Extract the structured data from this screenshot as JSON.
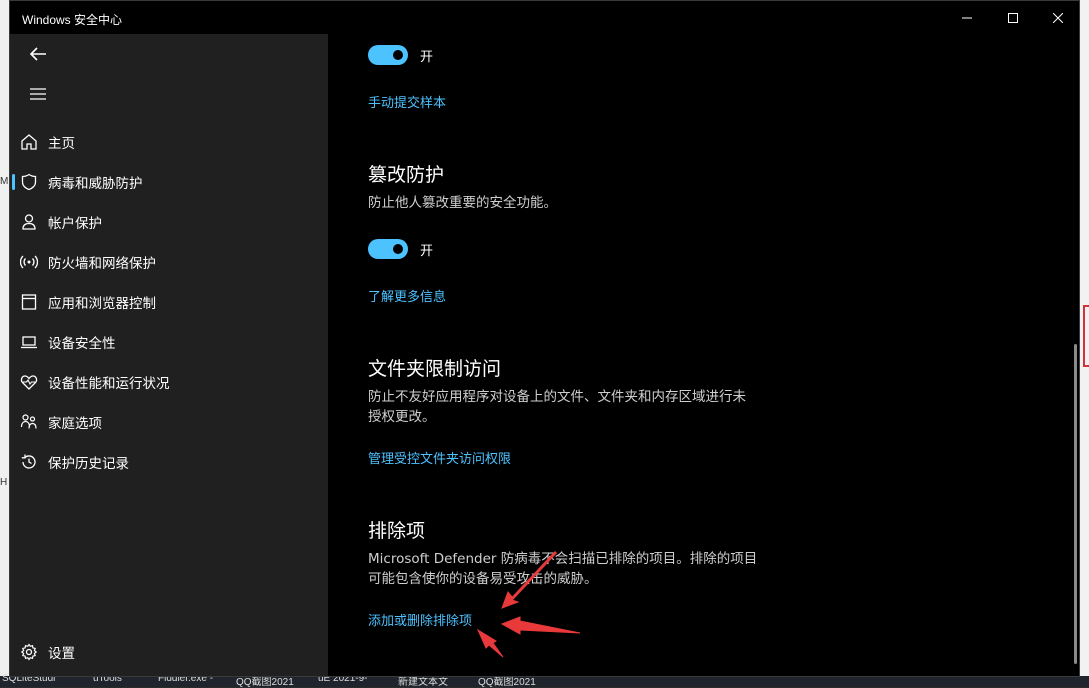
{
  "window": {
    "title": "Windows 安全中心"
  },
  "nav": {
    "items": [
      {
        "label": "主页",
        "icon": "home-icon"
      },
      {
        "label": "病毒和威胁防护",
        "icon": "shield-icon",
        "active": true
      },
      {
        "label": "帐户保护",
        "icon": "person-icon"
      },
      {
        "label": "防火墙和网络保护",
        "icon": "wifi-antenna-icon"
      },
      {
        "label": "应用和浏览器控制",
        "icon": "app-window-icon"
      },
      {
        "label": "设备安全性",
        "icon": "laptop-icon"
      },
      {
        "label": "设备性能和运行状况",
        "icon": "heart-pulse-icon"
      },
      {
        "label": "家庭选项",
        "icon": "family-icon"
      },
      {
        "label": "保护历史记录",
        "icon": "history-icon"
      }
    ],
    "settings_label": "设置"
  },
  "content": {
    "toggle1_label": "开",
    "link_submit_sample": "手动提交样本",
    "tamper": {
      "heading": "篡改防护",
      "desc": "防止他人篡改重要的安全功能。",
      "toggle_label": "开",
      "link": "了解更多信息"
    },
    "folder": {
      "heading": "文件夹限制访问",
      "desc": "防止不友好应用程序对设备上的文件、文件夹和内存区域进行未授权更改。",
      "link": "管理受控文件夹访问权限"
    },
    "exclusions": {
      "heading": "排除项",
      "desc": "Microsoft Defender 防病毒不会扫描已排除的项目。排除的项目可能包含使你的设备易受攻击的威胁。",
      "link": "添加或删除排除项"
    }
  },
  "taskbar": [
    "SQLiteStudi",
    "uTools",
    "Fiddler.exe -",
    "QQ截图2021",
    "uE 2021-9-",
    "新建文本文",
    "QQ截图2021"
  ],
  "desktop_left_chars": [
    "M",
    "H"
  ],
  "colors": {
    "accent": "#4cc2ff",
    "annotation_arrow": "#e8393b"
  }
}
